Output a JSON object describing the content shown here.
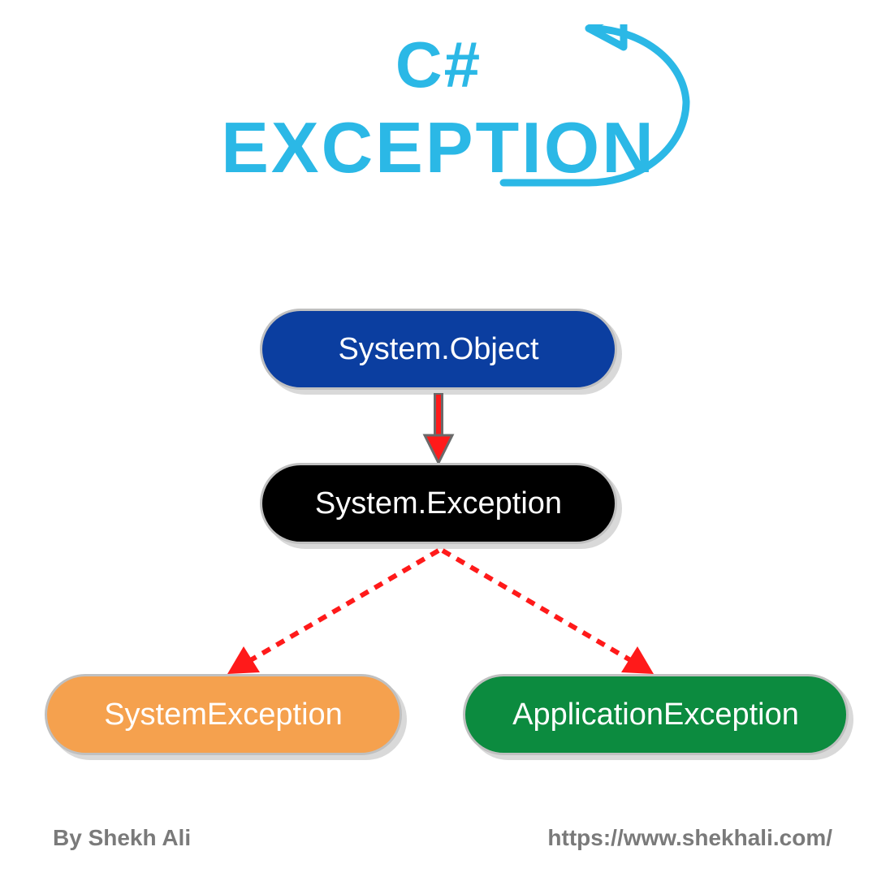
{
  "title": {
    "line1": "C#",
    "line2": "EXCEPTION"
  },
  "nodes": {
    "object": {
      "label": "System.Object",
      "color": "#0b3ea0"
    },
    "exception": {
      "label": "System.Exception",
      "color": "#000000"
    },
    "systemException": {
      "label": "SystemException",
      "color": "#f5a14e"
    },
    "applicationException": {
      "label": "ApplicationException",
      "color": "#0c8b3f"
    }
  },
  "edges": {
    "object_to_exception": {
      "style": "solid",
      "color_stroke": "#6a6a6a",
      "color_fill": "#ff1a1a"
    },
    "exception_to_system": {
      "style": "dashed",
      "color": "#ff1a1a"
    },
    "exception_to_application": {
      "style": "dashed",
      "color": "#ff1a1a"
    }
  },
  "footer": {
    "author": "By Shekh Ali",
    "url": "https://www.shekhali.com/"
  },
  "accent_color": "#2bb8e6"
}
